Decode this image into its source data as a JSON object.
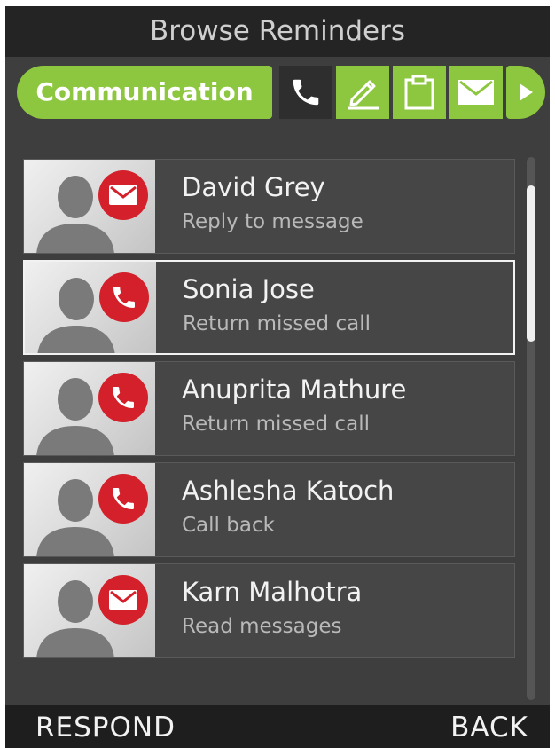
{
  "title": "Browse Reminders",
  "filter": {
    "category_label": "Communication",
    "tabs": [
      {
        "icon": "phone-icon",
        "active": true
      },
      {
        "icon": "pencil-icon",
        "active": false
      },
      {
        "icon": "clipboard-icon",
        "active": false
      },
      {
        "icon": "mail-icon",
        "active": false
      },
      {
        "icon": "arrow-right-icon",
        "active": false
      }
    ]
  },
  "reminders": [
    {
      "name": "David Grey",
      "action": "Reply to message",
      "badge": "mail-icon",
      "selected": false
    },
    {
      "name": "Sonia Jose",
      "action": "Return missed call",
      "badge": "phone-icon",
      "selected": true
    },
    {
      "name": "Anuprita Mathure",
      "action": "Return missed call",
      "badge": "phone-icon",
      "selected": false
    },
    {
      "name": "Ashlesha Katoch",
      "action": "Call back",
      "badge": "phone-icon",
      "selected": false
    },
    {
      "name": "Karn Malhotra",
      "action": "Read messages",
      "badge": "mail-icon",
      "selected": false
    }
  ],
  "softkeys": {
    "left": "RESPOND",
    "right": "BACK"
  },
  "colors": {
    "accent_green": "#8dc63f",
    "badge_red": "#d3202a",
    "background": "#3e3e3e",
    "header_bg": "#242424"
  }
}
